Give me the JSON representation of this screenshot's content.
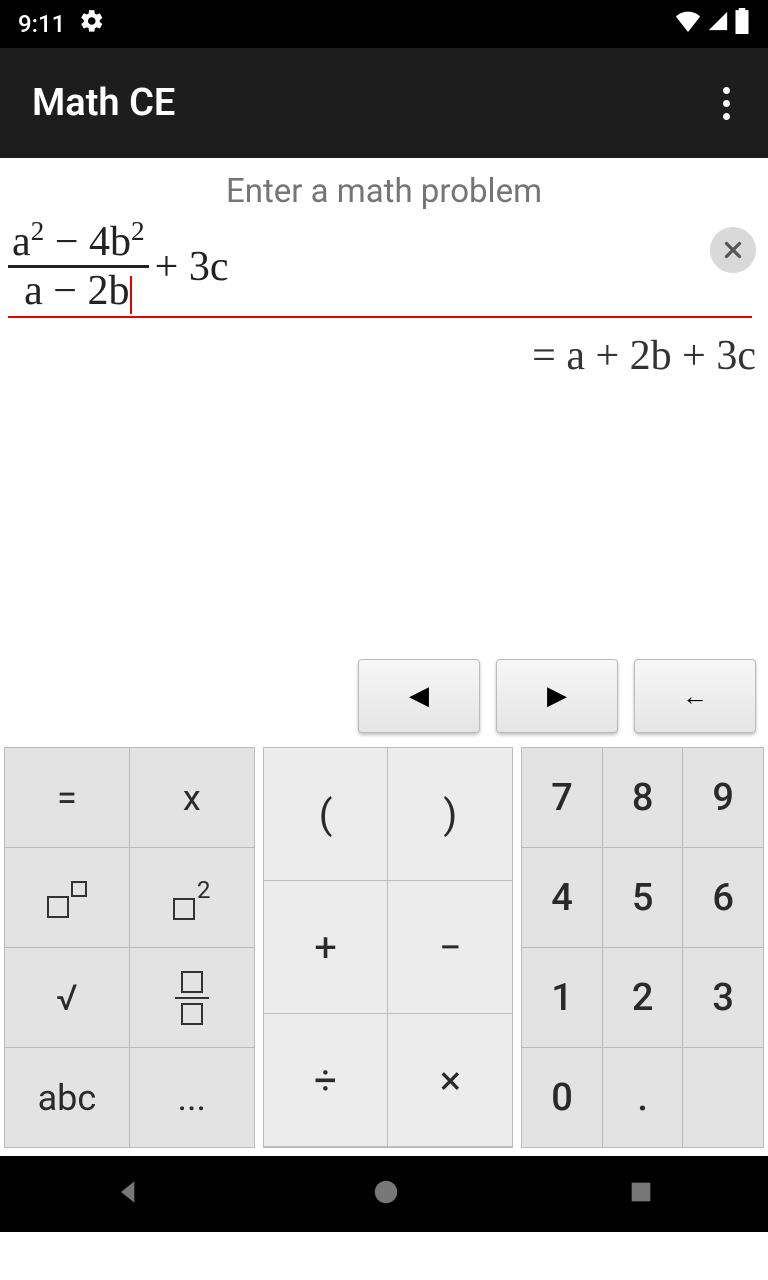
{
  "status": {
    "time": "9:11"
  },
  "appbar": {
    "title": "Math CE"
  },
  "main": {
    "prompt": "Enter a math problem",
    "expression": {
      "numerator_a": "a",
      "numerator_exp1": "2",
      "numerator_minus": " − 4b",
      "numerator_exp2": "2",
      "denominator": "a − 2b",
      "tail": " + 3c"
    },
    "result": "= a + 2b + 3c"
  },
  "nav": {
    "left": "◀",
    "right": "▶",
    "back": "←"
  },
  "keys": {
    "left": [
      "=",
      "x",
      "□^□",
      "□²",
      "√",
      "frac",
      "abc",
      "..."
    ],
    "mid": [
      "(",
      ")",
      "+",
      "−",
      "÷",
      "×"
    ],
    "right": [
      "7",
      "8",
      "9",
      "4",
      "5",
      "6",
      "1",
      "2",
      "3",
      "0",
      ".",
      ""
    ]
  }
}
